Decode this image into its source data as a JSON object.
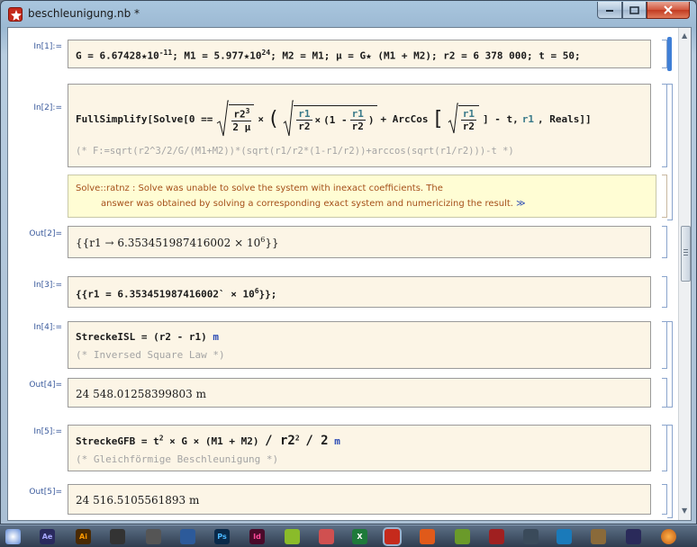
{
  "window": {
    "title": "beschleunigung.nb *"
  },
  "labels": {
    "in1": "In[1]:=",
    "in2": "In[2]:=",
    "out2": "Out[2]=",
    "in3": "In[3]:=",
    "in4": "In[4]:=",
    "out4": "Out[4]=",
    "in5": "In[5]:=",
    "out5": "Out[5]="
  },
  "cells": {
    "in1": {
      "g_part": "G = 6.67428",
      "g_times": "★",
      "g_base": "10",
      "g_exp": "-11",
      "m1_part": "; M1 = 5.977",
      "m1_times": "★",
      "m1_base": "10",
      "m1_exp": "24",
      "rest": "; M2 = M1; μ = G★ (M1 + M2); r2 = 6 378 000; t = 50;"
    },
    "in2": {
      "code_pre": "FullSimplify[Solve[0 ==",
      "sqrt_num": "r2",
      "sqrt_num_exp": "3",
      "sqrt_den": "2 μ",
      "times": "×",
      "r1": "r1",
      "r2": "r2",
      "one_minus": "(1 -",
      "arccos": "+ ArcCos",
      "tail_a": "] - t,",
      "tail_var": "r1",
      "tail_b": ", Reals]]",
      "comment": "(* F:=sqrt(r2^3/2/G/(M1+M2))*(sqrt(r1/r2*(1-r1/r2))+arccos(sqrt(r1/r2)))-t *)"
    },
    "message": {
      "line1": "Solve::ratnz :  Solve was unable to solve the system with inexact coefficients. The",
      "line2": "answer was obtained by solving a corresponding exact system and numericizing the result.",
      "more": "≫"
    },
    "out2": {
      "pre": "{{r1 → 6.353451987416002",
      "times": "×",
      "base": "10",
      "exp": "6",
      "post": "}}"
    },
    "in3": {
      "pre": "{{r1 = 6.353451987416002`",
      "times": "×",
      "base": "10",
      "exp": "6",
      "post": "}};"
    },
    "in4": {
      "code": "StreckeISL = (r2 - r1)",
      "unit": "m",
      "comment": "(* Inversed Square Law *)"
    },
    "out4": {
      "value": "24 548.01258399803 m"
    },
    "in5": {
      "code_a": "StreckeGFB = t",
      "code_exp_a": "2",
      "code_b": "× G × (M1 + M2)",
      "code_c": "/ r2",
      "code_exp_b": "2",
      "code_d": "/ 2",
      "unit": "m",
      "comment": "(* Gleichförmige Beschleunigung *)"
    },
    "out5": {
      "value": "24 516.5105561893 m"
    }
  },
  "taskbar": {
    "items": [
      "Ae",
      "Ai",
      "Ps",
      "Id",
      "X"
    ]
  },
  "colors": {
    "input_bg": "#fcf5e6",
    "message_bg": "#fffdd4",
    "message_text": "#a5501a",
    "label": "#3a5a9c"
  }
}
